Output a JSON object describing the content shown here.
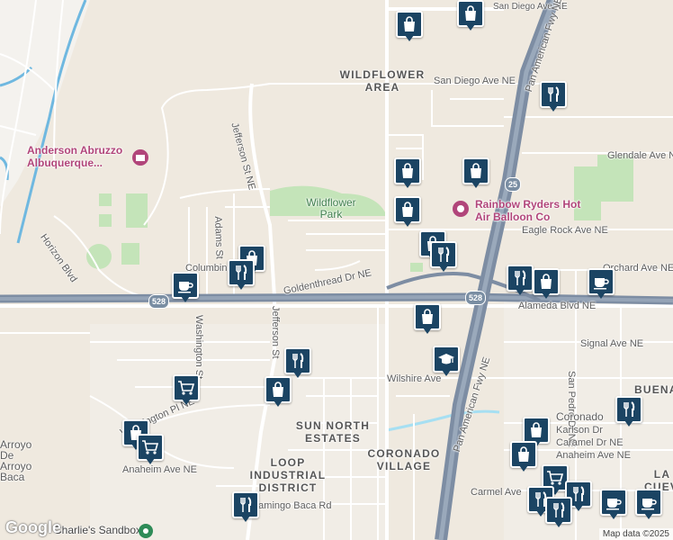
{
  "labels": {
    "wildflower_area": "WILDFLOWER AREA",
    "san_diego_ave": "San Diego Ave NE",
    "san_diego_ave_top": "San Diego Ave NE",
    "pan_american_fwy_top": "Pan American Fwy NE",
    "pan_american_fwy_bottom": "Pan American Fwy NE",
    "anderson_abruzzo": "Anderson Abruzzo Albuquerque...",
    "jefferson_st_top": "Jefferson St NE",
    "jefferson_st_bottom": "Jefferson St",
    "adams_st": "Adams St",
    "wildflower_park": "Wildflower Park",
    "rainbow_ryders": "Rainbow Ryders Hot Air Balloon Co",
    "glendale_ave": "Glendale Ave NE",
    "eagle_rock_ave": "Eagle Rock Ave NE",
    "horizon_blvd": "Horizon Blvd",
    "columbine": "Columbine",
    "goldenthread_dr": "Goldenthread Dr NE",
    "orchard_ave": "Orchard Ave NE",
    "alameda_blvd": "Alameda Blvd NE",
    "signal_ave": "Signal Ave NE",
    "washington_st": "Washington St",
    "wilshire_ave": "Wilshire Ave",
    "san_pedro_dr": "San Pedro Dr NE",
    "washington_pl": "Washington Pl NE",
    "sun_north_estates": "SUN NORTH ESTATES",
    "coronado_village": "CORONADO VILLAGE",
    "loop_industrial": "LOOP INDUSTRIAL DISTRICT",
    "coronado": "Coronado",
    "karlson_dr": "Karlson Dr",
    "caramel_dr": "Caramel Dr NE",
    "anaheim_ave_right": "Anaheim Ave NE",
    "anaheim_ave_left": "Anaheim Ave NE",
    "carmel_ave": "Carmel Ave",
    "flamingo_baca": "Flamingo Baca Rd",
    "charlies_sandbox": "Charlie's Sandbox",
    "arroyo_de_baca": "Arroyo De Arroyo Baca",
    "buena": "BUENA",
    "la_cueva": "LA CUEVA"
  },
  "shields": [
    "528",
    "528",
    "25"
  ],
  "attribution": "Map data ©2025",
  "google": "Google",
  "pins": [
    {
      "icon": "bag"
    },
    {
      "icon": "bag"
    },
    {
      "icon": "fork"
    },
    {
      "icon": "bag"
    },
    {
      "icon": "bag"
    },
    {
      "icon": "bag"
    },
    {
      "icon": "bag"
    },
    {
      "icon": "fork"
    },
    {
      "icon": "bag"
    },
    {
      "icon": "fork"
    },
    {
      "icon": "cup"
    },
    {
      "icon": "fork"
    },
    {
      "icon": "bag"
    },
    {
      "icon": "cup"
    },
    {
      "icon": "bag"
    },
    {
      "icon": "cap"
    },
    {
      "icon": "fork"
    },
    {
      "icon": "bag"
    },
    {
      "icon": "cart"
    },
    {
      "icon": "bag"
    },
    {
      "icon": "cart"
    },
    {
      "icon": "fork"
    },
    {
      "icon": "bag"
    },
    {
      "icon": "bag"
    },
    {
      "icon": "cart"
    },
    {
      "icon": "fork"
    },
    {
      "icon": "fork"
    },
    {
      "icon": "fork"
    },
    {
      "icon": "cup"
    },
    {
      "icon": "cup"
    },
    {
      "icon": "fork"
    }
  ],
  "colors": {
    "pin": "#1b4463",
    "park": "#c4e4b9",
    "freeway": "#7d8da3",
    "water": "#6fb8e0"
  }
}
